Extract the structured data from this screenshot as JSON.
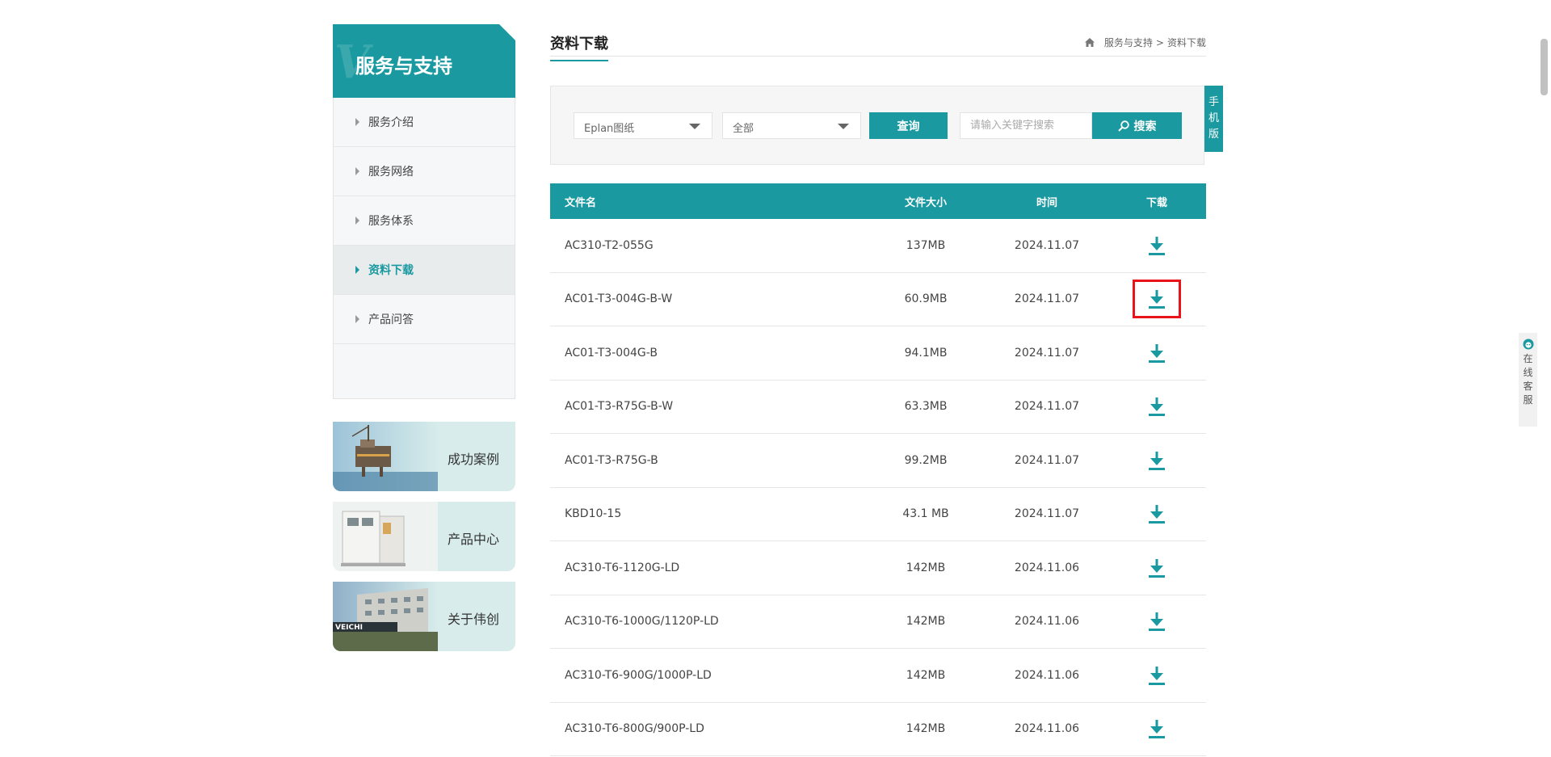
{
  "sidebar": {
    "title": "服务与支持",
    "ghost_text": "V",
    "items": [
      {
        "label": "服务介绍"
      },
      {
        "label": "服务网络"
      },
      {
        "label": "服务体系"
      },
      {
        "label": "资料下载",
        "active": true
      },
      {
        "label": "产品问答"
      }
    ],
    "promos": [
      {
        "label": "成功案例"
      },
      {
        "label": "产品中心"
      },
      {
        "label": "关于伟创"
      }
    ]
  },
  "header": {
    "title": "资料下载",
    "breadcrumb": {
      "parent": "服务与支持",
      "separator": ">",
      "current": "资料下载"
    }
  },
  "filter": {
    "category_value": "Eplan图纸",
    "type_value": "全部",
    "query_label": "查询",
    "search_placeholder": "请输入关键字搜索",
    "search_label": "搜索"
  },
  "mobile_tab": [
    "手",
    "机",
    "版"
  ],
  "table": {
    "headers": {
      "name": "文件名",
      "size": "文件大小",
      "time": "时间",
      "download": "下载"
    },
    "rows": [
      {
        "name": "AC310-T2-055G",
        "size": "137MB",
        "time": "2024.11.07"
      },
      {
        "name": "AC01-T3-004G-B-W",
        "size": "60.9MB",
        "time": "2024.11.07",
        "highlighted": true
      },
      {
        "name": "AC01-T3-004G-B",
        "size": "94.1MB",
        "time": "2024.11.07"
      },
      {
        "name": "AC01-T3-R75G-B-W",
        "size": "63.3MB",
        "time": "2024.11.07"
      },
      {
        "name": "AC01-T3-R75G-B",
        "size": "99.2MB",
        "time": "2024.11.07"
      },
      {
        "name": "KBD10-15",
        "size": "43.1 MB",
        "time": "2024.11.07"
      },
      {
        "name": "AC310-T6-1120G-LD",
        "size": "142MB",
        "time": "2024.11.06"
      },
      {
        "name": "AC310-T6-1000G/1120P-LD",
        "size": "142MB",
        "time": "2024.11.06"
      },
      {
        "name": "AC310-T6-900G/1000P-LD",
        "size": "142MB",
        "time": "2024.11.06"
      },
      {
        "name": "AC310-T6-800G/900P-LD",
        "size": "142MB",
        "time": "2024.11.06"
      }
    ]
  },
  "online_service": [
    "在",
    "线",
    "客",
    "服"
  ],
  "colors": {
    "accent": "#1a9aa0",
    "highlight": "#e8141a",
    "promo_bg": "#d7eceb"
  },
  "icons": {
    "download": "download-icon",
    "search": "search-icon",
    "home": "home-icon",
    "service": "customer-service-icon"
  }
}
